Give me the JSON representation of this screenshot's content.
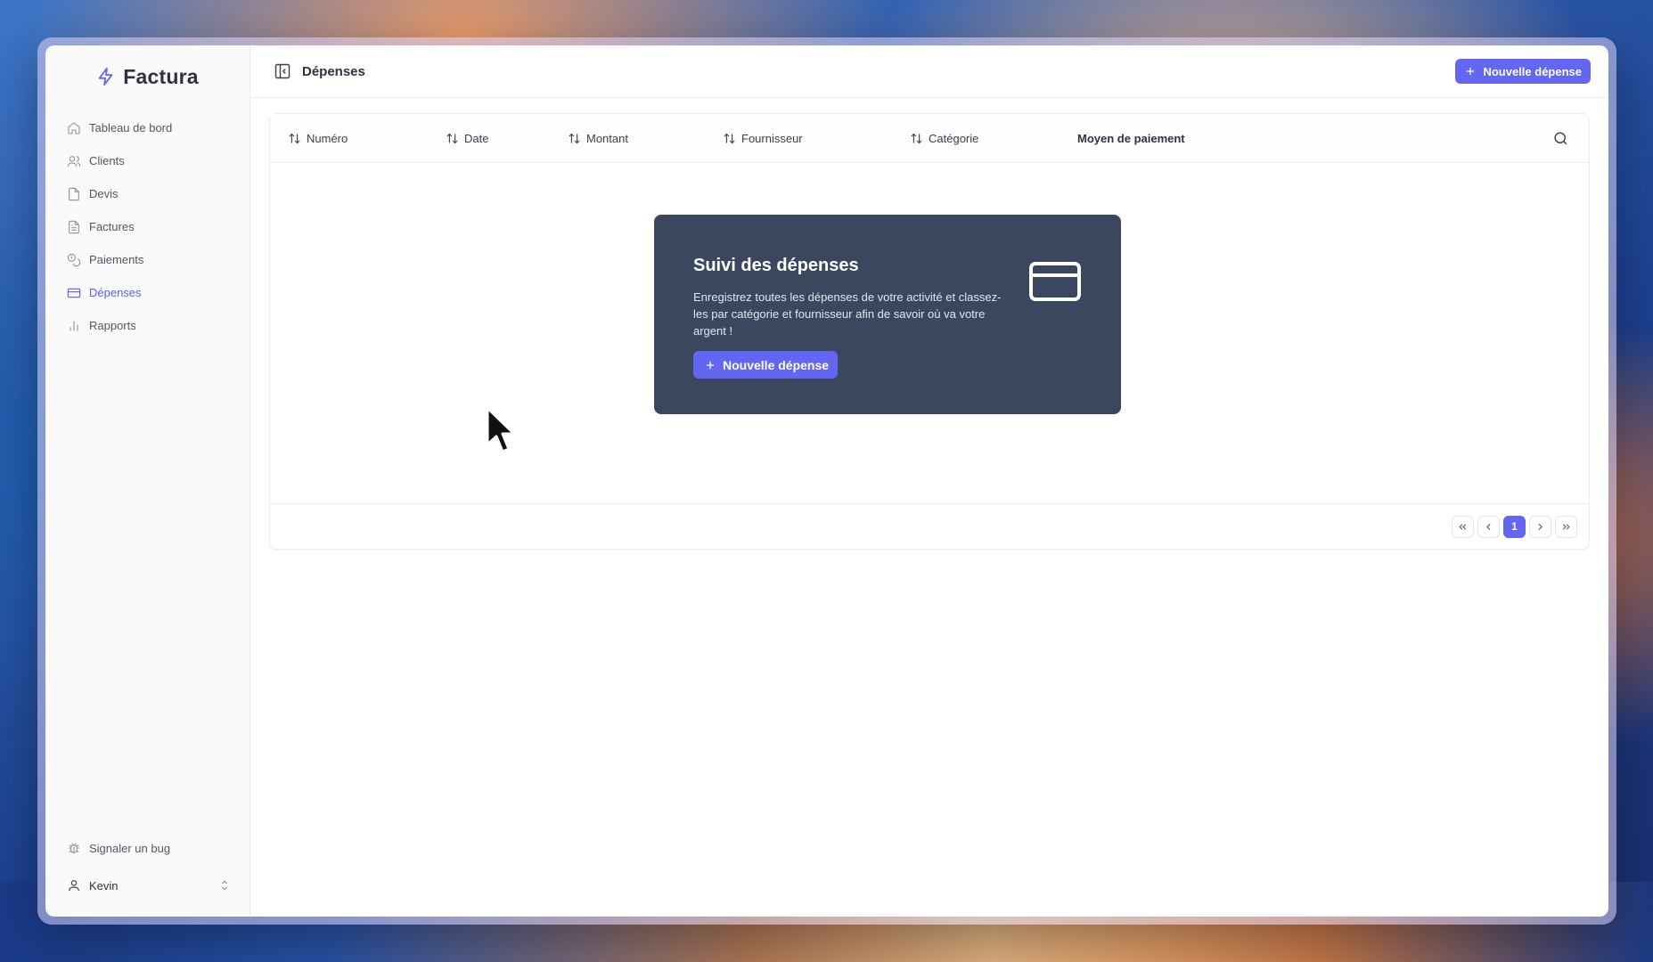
{
  "app": {
    "name": "Factura"
  },
  "sidebar": {
    "items": [
      {
        "label": "Tableau de bord",
        "icon": "home-icon"
      },
      {
        "label": "Clients",
        "icon": "users-icon"
      },
      {
        "label": "Devis",
        "icon": "file-icon"
      },
      {
        "label": "Factures",
        "icon": "file-text-icon"
      },
      {
        "label": "Paiements",
        "icon": "coins-icon"
      },
      {
        "label": "Dépenses",
        "icon": "credit-card-icon",
        "active": true
      },
      {
        "label": "Rapports",
        "icon": "bar-chart-icon"
      }
    ],
    "bug_label": "Signaler un bug",
    "user_name": "Kevin"
  },
  "header": {
    "title": "Dépenses",
    "new_button": "Nouvelle dépense"
  },
  "table": {
    "columns": [
      "Numéro",
      "Date",
      "Montant",
      "Fournisseur",
      "Catégorie",
      "Moyen de paiement"
    ]
  },
  "empty_state": {
    "title": "Suivi des dépenses",
    "text": "Enregistrez toutes les dépenses de votre activité et classez-les par catégorie et fournisseur afin de savoir où va votre argent !",
    "button": "Nouvelle dépense"
  },
  "pagination": {
    "current_page": "1"
  },
  "colors": {
    "accent": "#6366f1",
    "empty_card": "#3b475e"
  }
}
